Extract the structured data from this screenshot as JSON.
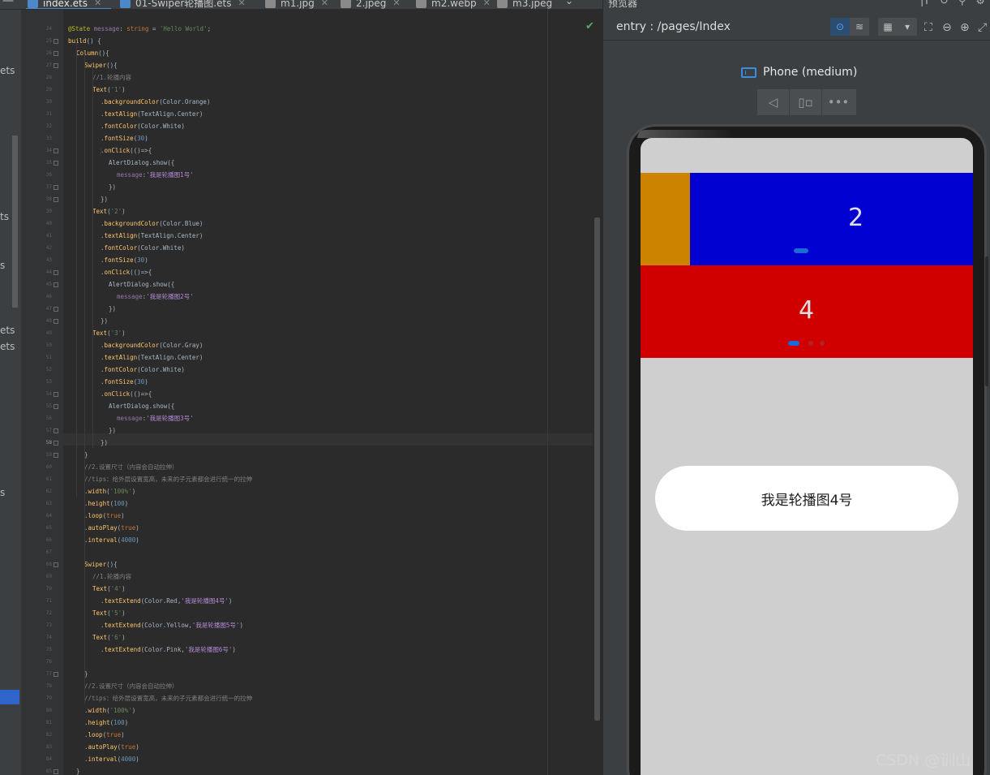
{
  "tabs": [
    {
      "label": "index.ets",
      "active": true,
      "color": "#4a88c7"
    },
    {
      "label": "01-Swiper轮播图.ets",
      "active": false,
      "color": "#4a88c7"
    },
    {
      "label": "m1.jpg",
      "active": false,
      "color": "#8a8a8a"
    },
    {
      "label": "2.jpeg",
      "active": false,
      "color": "#8a8a8a"
    },
    {
      "label": "m2.webp",
      "active": false,
      "color": "#8a8a8a"
    },
    {
      "label": "m3.jpeg",
      "active": false,
      "color": "#8a8a8a"
    }
  ],
  "project_fragments": [
    "ets",
    "ts",
    "s",
    "ets",
    "ets",
    "s"
  ],
  "line_numbers": [
    "24",
    "25",
    "26",
    "27",
    "28",
    "29",
    "30",
    "31",
    "32",
    "33",
    "34",
    "35",
    "36",
    "37",
    "38",
    "39",
    "40",
    "41",
    "42",
    "43",
    "44",
    "45",
    "46",
    "47",
    "48",
    "49",
    "50",
    "51",
    "52",
    "53",
    "54",
    "55",
    "56",
    "57",
    "58",
    "59",
    "60",
    "61",
    "62",
    "63",
    "64",
    "65",
    "66",
    "67",
    "68",
    "69",
    "70",
    "71",
    "72",
    "73",
    "74",
    "75",
    "76",
    "77",
    "78",
    "79",
    "80",
    "81",
    "82",
    "83",
    "84",
    "85"
  ],
  "current_line": "58",
  "code": {
    "l24": "@State message: string = 'Hello World';",
    "l25": "build() {",
    "l26": "Column(){",
    "l27": "Swiper(){",
    "l28": "//1.轮播内容",
    "l29": "Text('1')",
    "l30": ".backgroundColor(Color.Orange)",
    "l31": ".textAlign(TextAlign.Center)",
    "l32": ".fontColor(Color.White)",
    "l33": ".fontSize(30)",
    "l34": ".onClick(()=>{",
    "l35": "AlertDialog.show({",
    "l36": "message:'我是轮播图1号'",
    "l37": "})",
    "l38": "})",
    "l39": "Text('2')",
    "l40": ".backgroundColor(Color.Blue)",
    "l41": ".textAlign(TextAlign.Center)",
    "l42": ".fontColor(Color.White)",
    "l43": ".fontSize(30)",
    "l44": ".onClick(()=>{",
    "l45": "AlertDialog.show({",
    "l46": "message:'我是轮播图2号'",
    "l47": "})",
    "l48": "})",
    "l49": "Text('3')",
    "l50": ".backgroundColor(Color.Gray)",
    "l51": ".textAlign(TextAlign.Center)",
    "l52": ".fontColor(Color.White)",
    "l53": ".fontSize(30)",
    "l54": ".onClick(()=>{",
    "l55": "AlertDialog.show({",
    "l56": "message:'我是轮播图3号'",
    "l57": "})",
    "l58": "})",
    "l59": "}",
    "l60": "//2.设置尺寸（内容会自动拉伸）",
    "l61": "//tips：给外层设置宽高，未来的子元素都会进行统一的拉伸",
    "l62": ".width('100%')",
    "l63": ".height(100)",
    "l64": ".loop(true)",
    "l65": ".autoPlay(true)",
    "l66": ".interval(4000)",
    "l68": "Swiper(){",
    "l69": "//1.轮播内容",
    "l70": "Text('4')",
    "l71": ".textExtend(Color.Red,'我是轮播图4号')",
    "l72": "Text('5')",
    "l73": ".textExtend(Color.Yellow,'我是轮播图5号')",
    "l74": "Text('6')",
    "l75": ".textExtend(Color.Pink,'我是轮播图6号')",
    "l77": "}",
    "l78": "//2.设置尺寸（内容会自动拉伸）",
    "l79": "//tips：给外层设置宽高，未来的子元素都会进行统一的拉伸",
    "l80": ".width('100%')",
    "l81": ".height(100)",
    "l82": ".loop(true)",
    "l83": ".autoPlay(true)",
    "l84": ".interval(4000)",
    "l85": "}"
  },
  "previewer": {
    "title": "预览器",
    "route": "entry : /pages/Index",
    "device": "Phone (medium)",
    "swiper1": {
      "visible_slide": "2",
      "colors": {
        "left": "#cc8400",
        "main": "#0000d0"
      }
    },
    "swiper2": {
      "visible_slide": "4",
      "color": "#d00000"
    },
    "toast": "我是轮播图4号"
  },
  "watermark": "CSDN @训山"
}
